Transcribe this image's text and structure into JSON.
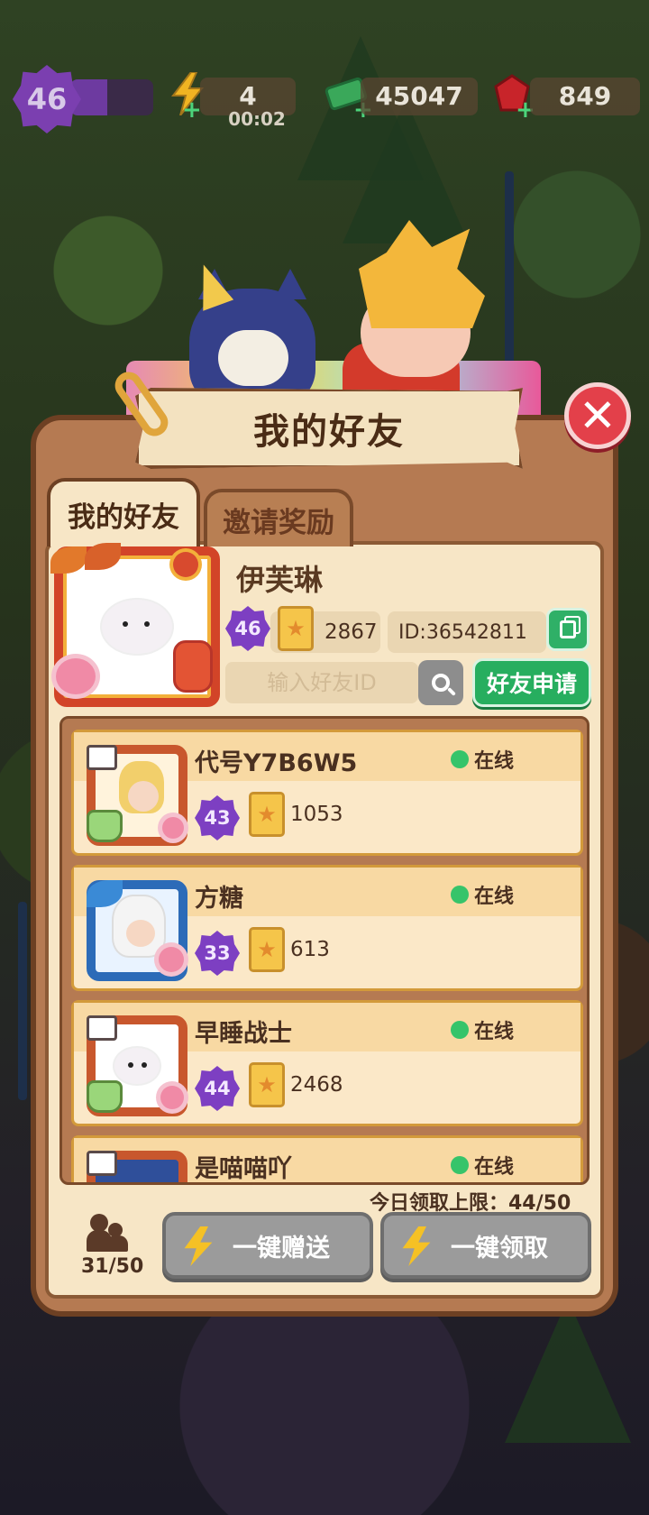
{
  "hud": {
    "level": "46",
    "level_progress": 0.45,
    "energy": "4",
    "energy_timer": "00:02",
    "cash": "45047",
    "gems": "849"
  },
  "dialog": {
    "title": "我的好友",
    "close_icon": "close-icon",
    "tabs": [
      {
        "label": "我的好友",
        "active": true
      },
      {
        "label": "邀请奖励",
        "active": false
      }
    ]
  },
  "profile": {
    "name": "伊芙琳",
    "level": "46",
    "cards": "2867",
    "id": "ID:36542811"
  },
  "search": {
    "placeholder": "输入好友ID",
    "apply_label": "好友申请"
  },
  "friends": [
    {
      "name": "代号Y7B6W5",
      "status": "在线",
      "level": "43",
      "cards": "1053"
    },
    {
      "name": "方糖",
      "status": "在线",
      "level": "33",
      "cards": "613"
    },
    {
      "name": "早睡战士",
      "status": "在线",
      "level": "44",
      "cards": "2468"
    },
    {
      "name": "是喵喵吖",
      "status": "在线",
      "level": "",
      "cards": ""
    }
  ],
  "footer": {
    "daily_limit": "今日领取上限：44/50",
    "friend_count": "31/50",
    "send_all_label": "一键赠送",
    "claim_all_label": "一键领取"
  },
  "colors": {
    "accent_green": "#27ae5f",
    "close_red": "#e3404a",
    "level_purple": "#7d3fc2",
    "panel_brown": "#b57a52"
  }
}
